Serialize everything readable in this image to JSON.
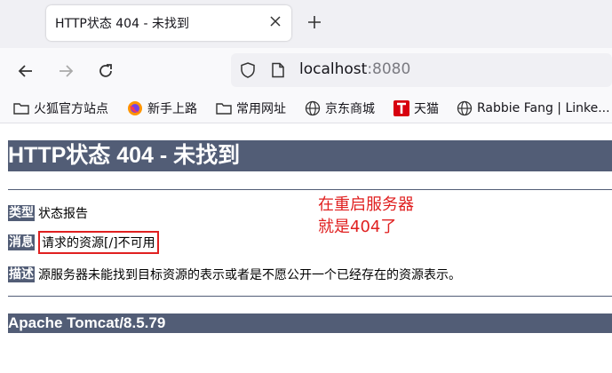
{
  "tab": {
    "title": "HTTP状态 404 - 未找到"
  },
  "address_bar": {
    "host": "localhost",
    "port": ":8080"
  },
  "bookmarks": [
    {
      "label": "火狐官方站点",
      "icon": "folder-icon"
    },
    {
      "label": "新手上路",
      "icon": "firefox-icon"
    },
    {
      "label": "常用网址",
      "icon": "folder-icon"
    },
    {
      "label": "京东商城",
      "icon": "globe-icon"
    },
    {
      "label": "天猫",
      "icon": "tmall-icon"
    },
    {
      "label": "Rabbie Fang | Linke...",
      "icon": "globe-icon"
    }
  ],
  "page": {
    "heading": "HTTP状态 404 - 未找到",
    "type_label": "类型",
    "type_value": "状态报告",
    "message_label": "消息",
    "message_value": "请求的资源[/]不可用",
    "description_label": "描述",
    "description_value": "源服务器未能找到目标资源的表示或者是不愿公开一个已经存在的资源表示。",
    "footer": "Apache Tomcat/8.5.79"
  },
  "annotation": {
    "line1": "在重启服务器",
    "line2": "就是404了"
  },
  "colors": {
    "header_bg": "#525d76",
    "annotation": "#e02020"
  }
}
